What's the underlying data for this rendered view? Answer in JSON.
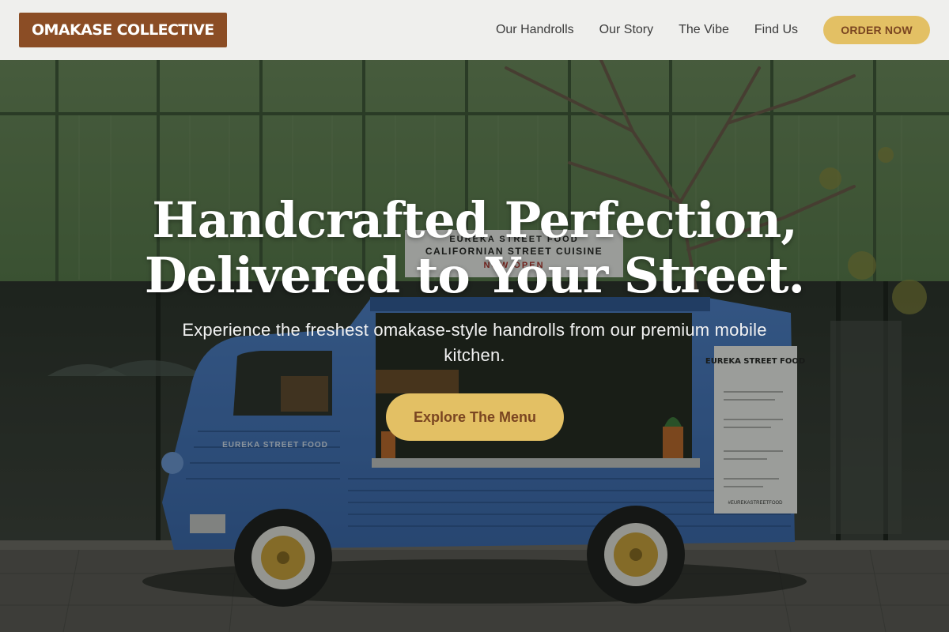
{
  "header": {
    "logo": "OMAKASE COLLECTIVE",
    "nav": [
      "Our Handrolls",
      "Our Story",
      "The Vibe",
      "Find Us"
    ],
    "order_button": "ORDER NOW"
  },
  "hero": {
    "headline_line1": "Handcrafted Perfection,",
    "headline_line2": "Delivered to Your Street.",
    "subtext": "Experience the freshest omakase-style handrolls from our premium mobile kitchen.",
    "cta": "Explore The Menu",
    "photo": {
      "truck_sign_line1": "EUREKA STREET FOOD",
      "truck_sign_line2": "CALIFORNIAN STREET CUISINE",
      "truck_sign_line3": "NOW OPEN",
      "truck_side_label": "EUREKA STREET FOOD",
      "menu_board_title": "EUREKA STREET FOOD",
      "menu_board_footer": "#EUREKASTREETFOOD"
    }
  },
  "colors": {
    "accent_gold": "#e3c064",
    "brand_brown": "#8b4d25",
    "header_bg": "#efefed",
    "truck_blue": "#3f6fb8"
  }
}
